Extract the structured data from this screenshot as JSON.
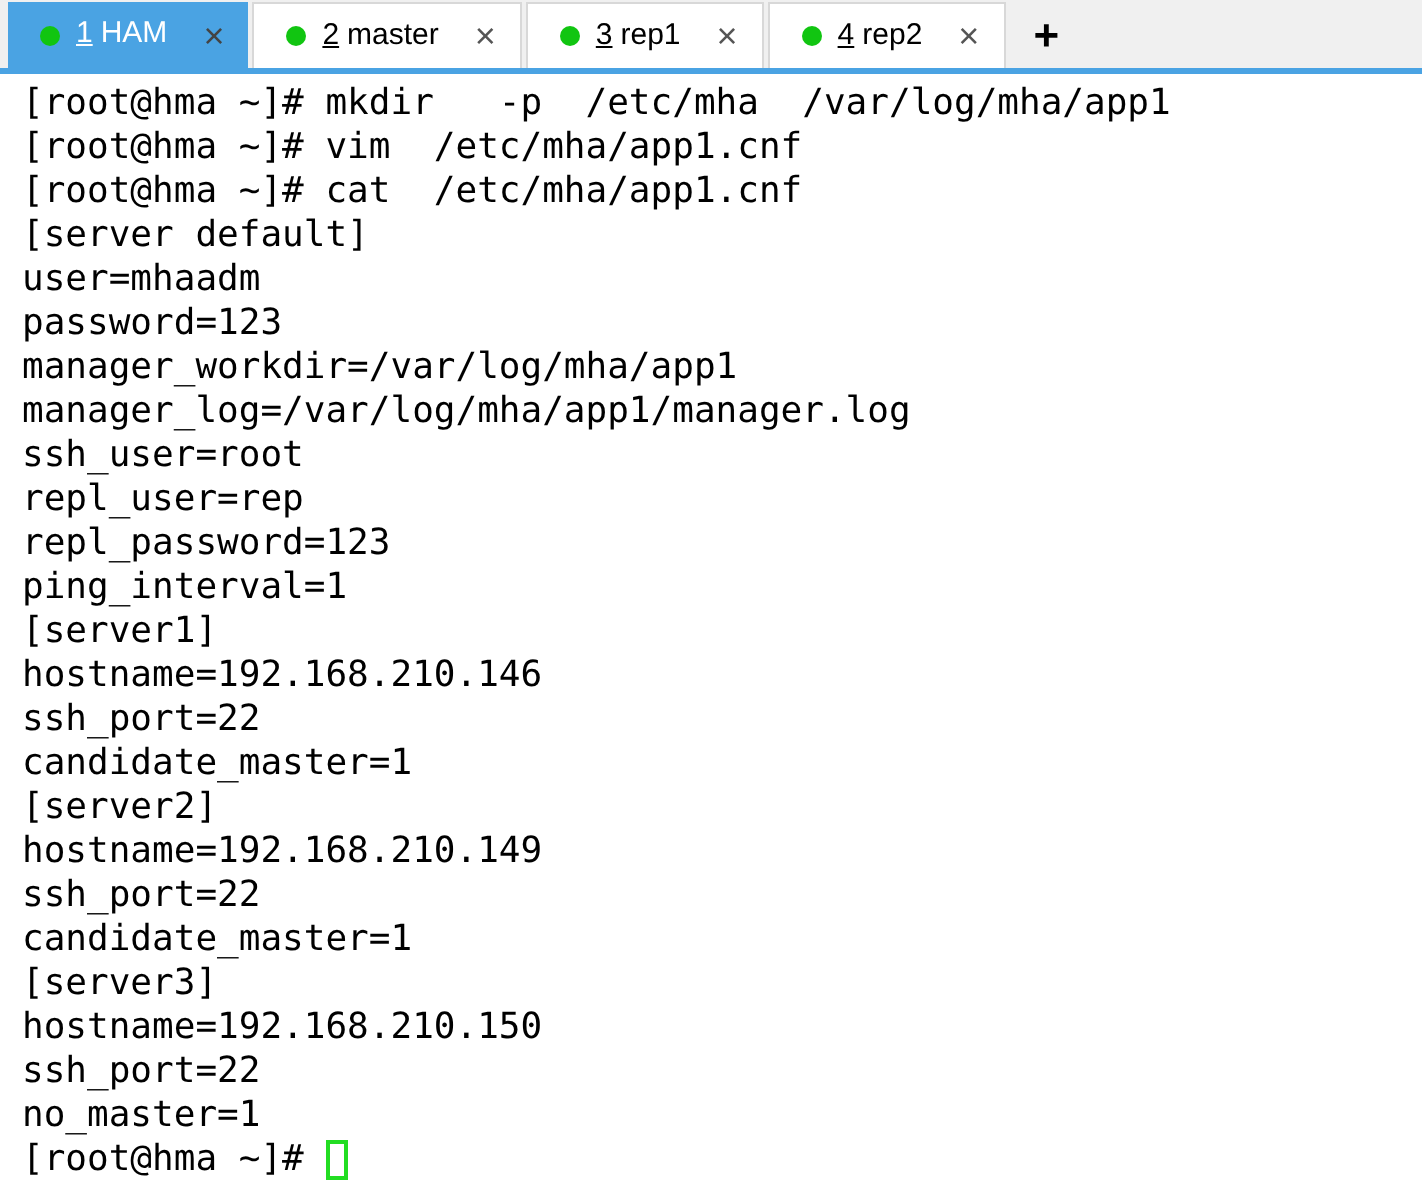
{
  "tabs": [
    {
      "number": "1",
      "label": "HAM",
      "selected": true,
      "close": "×"
    },
    {
      "number": "2",
      "label": "master",
      "selected": false,
      "close": "×"
    },
    {
      "number": "3",
      "label": "rep1",
      "selected": false,
      "close": "×"
    },
    {
      "number": "4",
      "label": "rep2",
      "selected": false,
      "close": "×"
    }
  ],
  "new_tab": "+",
  "terminal": {
    "lines": [
      "[root@hma ~]# mkdir   -p  /etc/mha  /var/log/mha/app1",
      "[root@hma ~]# vim  /etc/mha/app1.cnf",
      "[root@hma ~]# cat  /etc/mha/app1.cnf",
      "[server default]",
      "user=mhaadm",
      "password=123",
      "manager_workdir=/var/log/mha/app1",
      "manager_log=/var/log/mha/app1/manager.log",
      "ssh_user=root",
      "repl_user=rep",
      "repl_password=123",
      "ping_interval=1",
      "[server1]",
      "hostname=192.168.210.146",
      "ssh_port=22",
      "candidate_master=1",
      "[server2]",
      "hostname=192.168.210.149",
      "ssh_port=22",
      "candidate_master=1",
      "[server3]",
      "hostname=192.168.210.150",
      "ssh_port=22",
      "no_master=1"
    ],
    "prompt": "[root@hma ~]# ",
    "cursor": true
  }
}
